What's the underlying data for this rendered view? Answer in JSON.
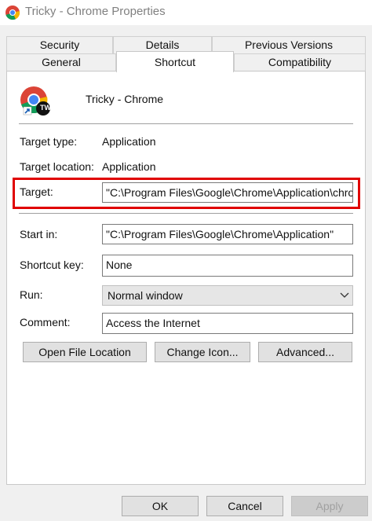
{
  "window": {
    "title": "Tricky - Chrome Properties"
  },
  "tabs": {
    "row1": [
      "Security",
      "Details",
      "Previous Versions"
    ],
    "row2": [
      "General",
      "Shortcut",
      "Compatibility"
    ],
    "active": "Shortcut"
  },
  "shortcut": {
    "name": "Tricky - Chrome",
    "badge_text": "TW",
    "target_type_label": "Target type:",
    "target_type": "Application",
    "target_location_label": "Target location:",
    "target_location": "Application",
    "target_label": "Target:",
    "target_value": "\"C:\\Program Files\\Google\\Chrome\\Application\\chrome.exe\"",
    "start_in_label": "Start in:",
    "start_in_value": "\"C:\\Program Files\\Google\\Chrome\\Application\"",
    "shortcut_key_label": "Shortcut key:",
    "shortcut_key_value": "None",
    "run_label": "Run:",
    "run_value": "Normal window",
    "comment_label": "Comment:",
    "comment_value": "Access the Internet",
    "open_file_location": "Open File Location",
    "change_icon": "Change Icon...",
    "advanced": "Advanced..."
  },
  "footer": {
    "ok": "OK",
    "cancel": "Cancel",
    "apply": "Apply"
  },
  "colors": {
    "highlight": "#e00000",
    "chrome_red": "#db4437",
    "chrome_yellow": "#f4b400",
    "chrome_green": "#0f9d58",
    "chrome_blue": "#4285f4"
  }
}
